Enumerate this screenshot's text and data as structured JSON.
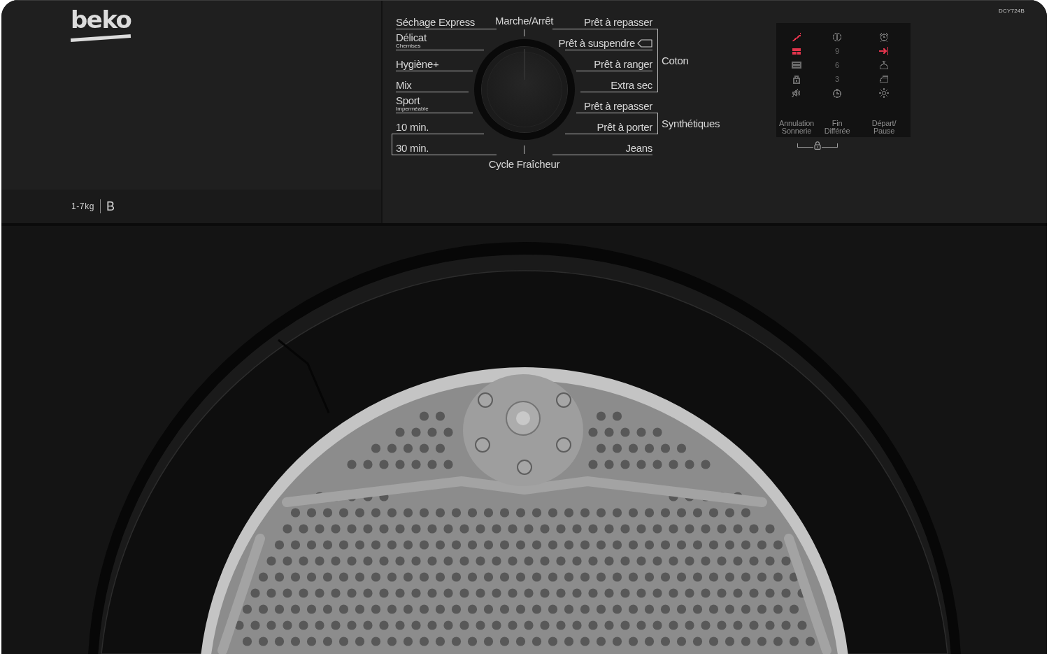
{
  "brand": {
    "logo": "beko"
  },
  "model": "DCY724B",
  "capacity": {
    "load": "1-7kg",
    "energy_class": "B"
  },
  "program_dial": {
    "top_label": "Marche/Arrêt",
    "bottom_label": "Cycle Fraîcheur",
    "left_column": [
      {
        "kind": "single",
        "label": "Séchage Express"
      },
      {
        "kind": "single",
        "label": "Délicat",
        "sublabel": "Chemises"
      },
      {
        "kind": "single",
        "label": "Hygiène+"
      },
      {
        "kind": "single",
        "label": "Mix"
      },
      {
        "kind": "single",
        "label": "Sport",
        "sublabel": "Imperméable"
      },
      {
        "kind": "group",
        "programs": [
          {
            "label": "10 min."
          },
          {
            "label": "30 min."
          }
        ]
      }
    ],
    "right_column": [
      {
        "kind": "group",
        "label": "Coton",
        "programs": [
          {
            "kind": "plain",
            "label": "Prêt à repasser"
          },
          {
            "kind": "tagged",
            "label": "Prêt à suspendre"
          },
          {
            "kind": "plain",
            "label": "Prêt à ranger"
          },
          {
            "kind": "plain",
            "label": "Extra sec"
          }
        ]
      },
      {
        "kind": "group",
        "label": "Synthétiques",
        "programs": [
          {
            "kind": "plain",
            "label": "Prêt à repasser"
          },
          {
            "kind": "plain",
            "label": "Prêt à porter"
          }
        ]
      },
      {
        "kind": "single",
        "label": "Jeans"
      }
    ]
  },
  "display": {
    "keys": [
      {
        "label": "Annulation\nSonnerie",
        "indicators": [
          {
            "kind": "icon",
            "color": "#e2344c"
          },
          {
            "kind": "icon",
            "color": "#e2344c"
          },
          {
            "kind": "icon",
            "color": "#6b6b6b"
          },
          {
            "kind": "icon",
            "color": "#6b6b6b"
          },
          {
            "kind": "icon",
            "color": "#6b6b6b"
          }
        ]
      },
      {
        "label": "Fin\nDifférée",
        "indicators": [
          {
            "kind": "icon",
            "color": "#6b6b6b"
          },
          {
            "kind": "digit",
            "text": "9"
          },
          {
            "kind": "digit",
            "text": "6"
          },
          {
            "kind": "digit",
            "text": "3"
          },
          {
            "kind": "icon",
            "color": "#6b6b6b"
          }
        ]
      },
      {
        "label": "Départ/\nPause",
        "indicators": [
          {
            "kind": "icon",
            "color": "#6b6b6b"
          },
          {
            "kind": "icon",
            "color": "#e2344c"
          },
          {
            "kind": "icon",
            "color": "#6b6b6b"
          },
          {
            "kind": "icon",
            "color": "#6b6b6b"
          },
          {
            "kind": "icon",
            "color": "#6b6b6b"
          }
        ]
      }
    ]
  }
}
